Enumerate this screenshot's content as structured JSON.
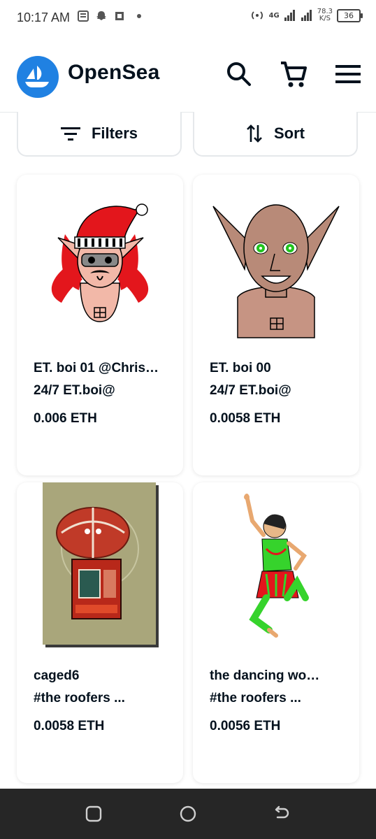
{
  "status_bar": {
    "time": "10:17 AM",
    "network": "4G",
    "speed_value": "78.3",
    "speed_unit": "K/S",
    "battery": "36"
  },
  "header": {
    "brand": "OpenSea",
    "brand_color": "#2081e2",
    "icons": [
      "search-icon",
      "cart-icon",
      "menu-icon"
    ]
  },
  "toolbar": {
    "filters_label": "Filters",
    "sort_label": "Sort"
  },
  "cards": [
    {
      "title": "ET. boi 01 @Chris…",
      "collection": "24/7 ET.boi@",
      "price": "0.006 ETH"
    },
    {
      "title": "ET. boi 00",
      "collection": "24/7 ET.boi@",
      "price": "0.0058 ETH"
    },
    {
      "title": "caged6",
      "collection": "#the roofers ...",
      "price": "0.0058 ETH"
    },
    {
      "title": "the dancing wo…",
      "collection": "#the roofers ...",
      "price": "0.0056 ETH"
    }
  ],
  "nav": {
    "icons": [
      "recents-icon",
      "home-icon",
      "back-icon"
    ]
  }
}
